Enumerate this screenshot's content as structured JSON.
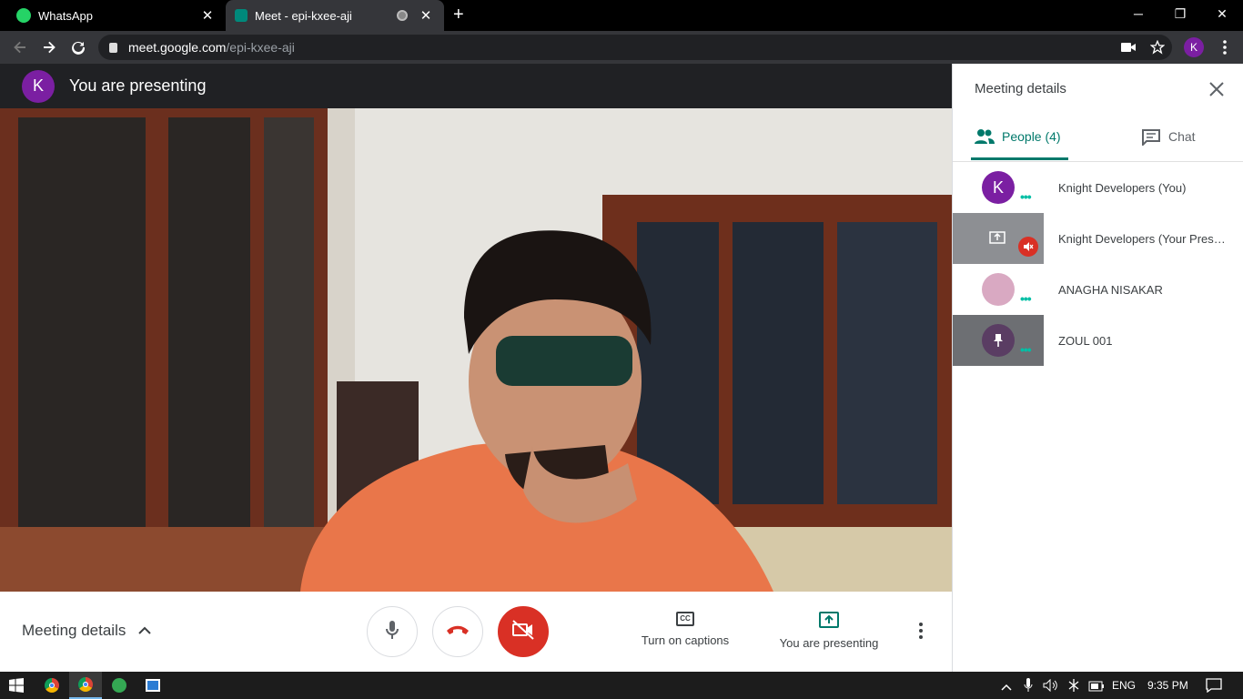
{
  "browser": {
    "tabs": [
      {
        "title": "WhatsApp",
        "close": "✕"
      },
      {
        "title": "Meet - epi-kxee-aji",
        "close": "✕"
      }
    ],
    "new_tab": "+",
    "url_host": "meet.google.com",
    "url_path": "/epi-kxee-aji",
    "profile_initial": "K",
    "window_controls": [
      "─",
      "❐",
      "✕"
    ]
  },
  "presenting_bar": {
    "avatar_initial": "K",
    "text": "You are presenting"
  },
  "bottom_bar": {
    "meeting_details": "Meeting details",
    "captions_label": "Turn on captions",
    "captions_icon": "CC",
    "presenting_label": "You are presenting"
  },
  "panel": {
    "title": "Meeting details",
    "tabs": [
      {
        "label": "People (4)",
        "active": true
      },
      {
        "label": "Chat",
        "active": false
      }
    ],
    "people": [
      {
        "name": "Knight Developers (You)",
        "initial": "K"
      },
      {
        "name": "Knight Developers (Your Presentation)"
      },
      {
        "name": "ANAGHA NISAKAR"
      },
      {
        "name": "ZOUL 001"
      }
    ]
  },
  "taskbar": {
    "language": "ENG",
    "time": "9:35 PM"
  },
  "colors": {
    "accent": "#00796b",
    "danger": "#d93025",
    "avatar": "#7b1fa2"
  }
}
